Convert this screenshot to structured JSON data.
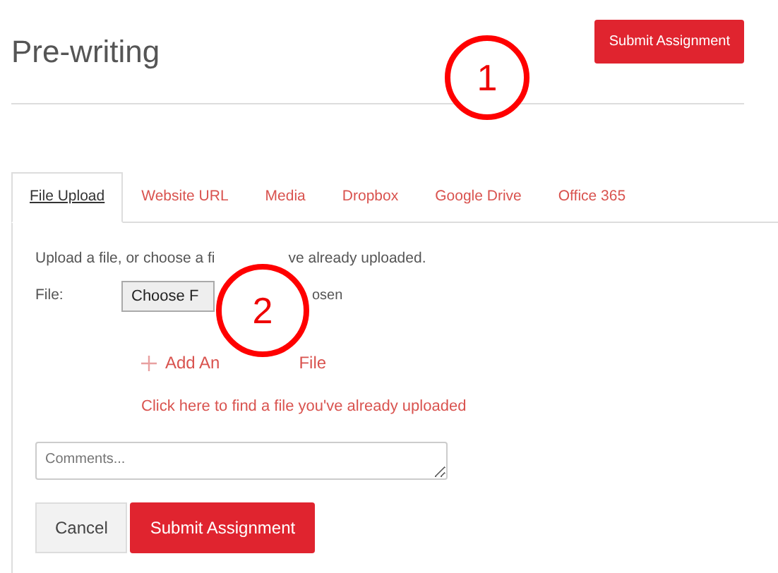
{
  "page": {
    "title": "Pre-writing",
    "submit_button": "Submit Assignment"
  },
  "tabs": [
    {
      "label": "File Upload",
      "selected": true
    },
    {
      "label": "Website URL",
      "selected": false
    },
    {
      "label": "Media",
      "selected": false
    },
    {
      "label": "Dropbox",
      "selected": false
    },
    {
      "label": "Google Drive",
      "selected": false
    },
    {
      "label": "Office 365",
      "selected": false
    }
  ],
  "upload": {
    "instructions": [
      "Upload a file, or choose a fi",
      "ve already uploaded."
    ],
    "file_label": "File:",
    "choose_button": "Choose F",
    "no_file_text": "osen",
    "add_file": [
      "Add An",
      "File"
    ],
    "find_link": "Click here to find a file you've already uploaded"
  },
  "comments": {
    "placeholder": "Comments..."
  },
  "buttons": [
    "Cancel",
    "Submit Assignment"
  ],
  "callouts": [
    "1",
    "2"
  ]
}
